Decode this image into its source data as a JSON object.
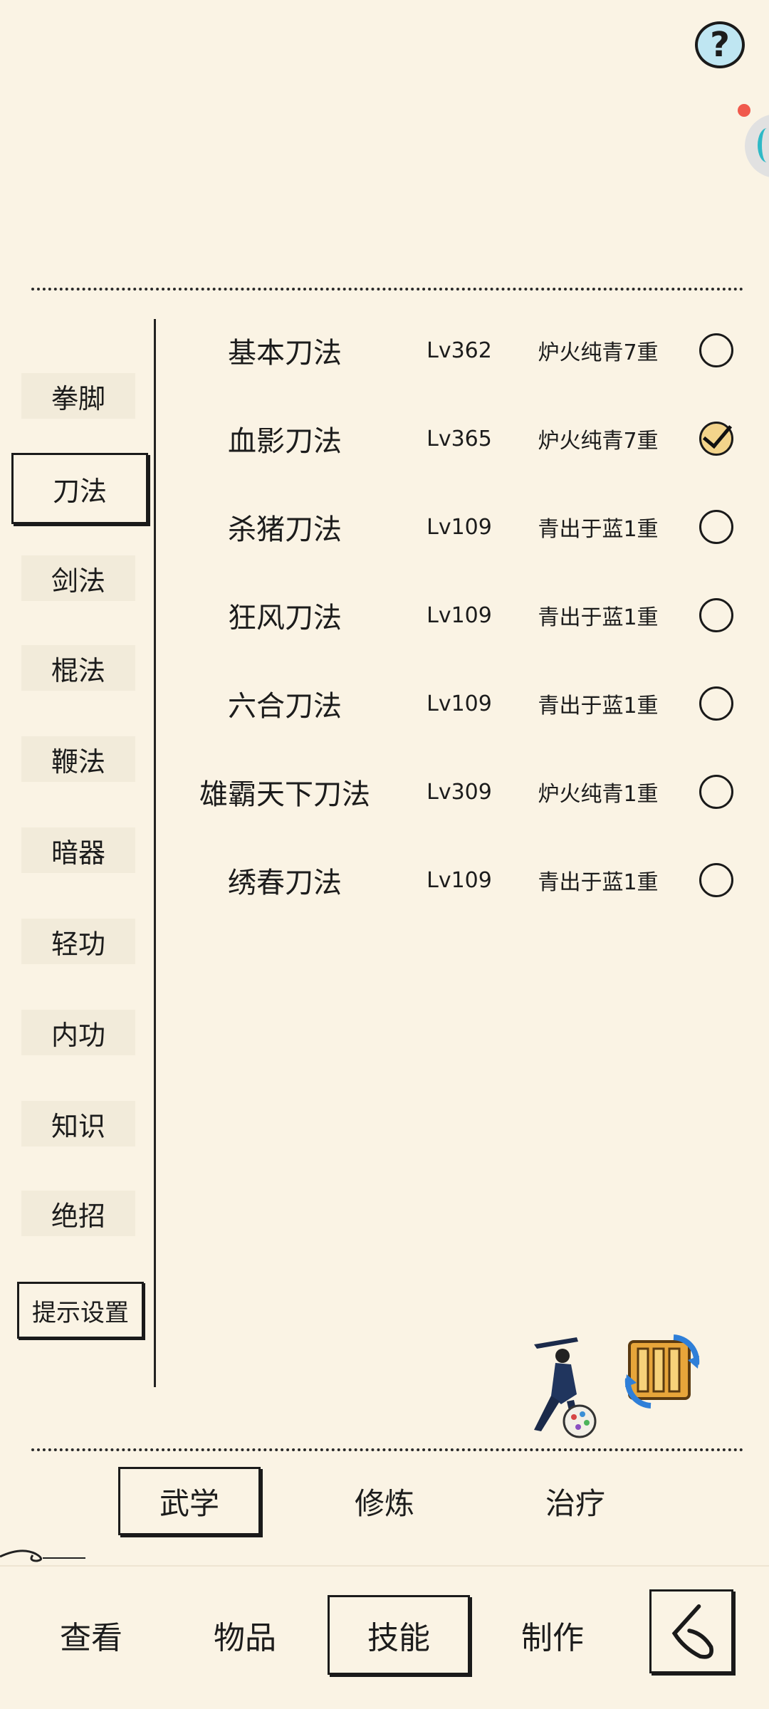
{
  "header": {
    "help_symbol": "?"
  },
  "categories": [
    {
      "label": "拳脚",
      "active": false
    },
    {
      "label": "刀法",
      "active": true
    },
    {
      "label": "剑法",
      "active": false
    },
    {
      "label": "棍法",
      "active": false
    },
    {
      "label": "鞭法",
      "active": false
    },
    {
      "label": "暗器",
      "active": false
    },
    {
      "label": "轻功",
      "active": false
    },
    {
      "label": "内功",
      "active": false
    },
    {
      "label": "知识",
      "active": false
    },
    {
      "label": "绝招",
      "active": false
    }
  ],
  "tip_settings_label": "提示设置",
  "skills": [
    {
      "name": "基本刀法",
      "level": "Lv362",
      "rank": "炉火纯青7重",
      "checked": false
    },
    {
      "name": "血影刀法",
      "level": "Lv365",
      "rank": "炉火纯青7重",
      "checked": true
    },
    {
      "name": "杀猪刀法",
      "level": "Lv109",
      "rank": "青出于蓝1重",
      "checked": false
    },
    {
      "name": "狂风刀法",
      "level": "Lv109",
      "rank": "青出于蓝1重",
      "checked": false
    },
    {
      "name": "六合刀法",
      "level": "Lv109",
      "rank": "青出于蓝1重",
      "checked": false
    },
    {
      "name": "雄霸天下刀法",
      "level": "Lv309",
      "rank": "炉火纯青1重",
      "checked": false
    },
    {
      "name": "绣春刀法",
      "level": "Lv109",
      "rank": "青出于蓝1重",
      "checked": false
    }
  ],
  "sub_tabs": [
    {
      "label": "武学",
      "active": true
    },
    {
      "label": "修炼",
      "active": false
    },
    {
      "label": "治疗",
      "active": false
    }
  ],
  "nav_tabs": [
    {
      "label": "查看",
      "active": false
    },
    {
      "label": "物品",
      "active": false
    },
    {
      "label": "技能",
      "active": true
    },
    {
      "label": "制作",
      "active": false
    }
  ],
  "colors": {
    "background": "#faf3e4",
    "checked_fill": "#f3d48b",
    "help_fill": "#bfe6f2",
    "notification_dot": "#f0594c"
  }
}
